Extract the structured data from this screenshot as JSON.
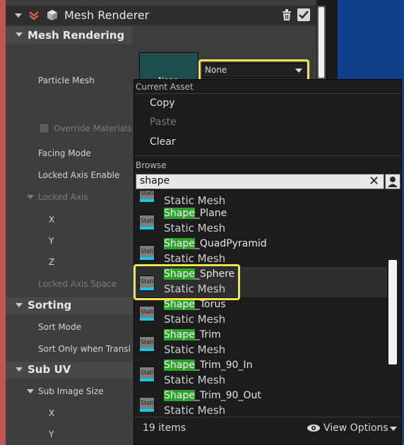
{
  "header": {
    "title": "Mesh Renderer"
  },
  "sections": {
    "mesh_rendering": "Mesh Rendering",
    "sorting": "Sorting",
    "sub_uv": "Sub UV"
  },
  "properties": {
    "particle_mesh": "Particle Mesh",
    "override_materials": "Override Materials",
    "facing_mode": "Facing Mode",
    "locked_axis_enable": "Locked Axis Enable",
    "locked_axis": "Locked Axis",
    "x": "X",
    "y": "Y",
    "z": "Z",
    "locked_axis_space": "Locked Axis Space",
    "sort_mode": "Sort Mode",
    "sort_only_when_translucent": "Sort Only when Transl",
    "sub_image_size": "Sub Image Size",
    "sub_x": "X",
    "sub_y": "Y"
  },
  "mesh_picker": {
    "thumbnail_label": "None",
    "selected_value": "None"
  },
  "popup": {
    "current_asset_title": "Current Asset",
    "copy": "Copy",
    "paste": "Paste",
    "clear": "Clear",
    "browse_title": "Browse",
    "search_value": "shape",
    "items": [
      {
        "highlight": "",
        "rest": "",
        "type": "Static Mesh"
      },
      {
        "highlight": "Shape",
        "rest": "_Plane",
        "type": "Static Mesh"
      },
      {
        "highlight": "Shape",
        "rest": "_QuadPyramid",
        "type": "Static Mesh"
      },
      {
        "highlight": "Shape",
        "rest": "_Sphere",
        "type": "Static Mesh"
      },
      {
        "highlight": "Shape",
        "rest": "_Torus",
        "type": "Static Mesh"
      },
      {
        "highlight": "Shape",
        "rest": "_Trim",
        "type": "Static Mesh"
      },
      {
        "highlight": "Shape",
        "rest": "_Trim_90_In",
        "type": "Static Mesh"
      },
      {
        "highlight": "Shape",
        "rest": "_Trim_90_Out",
        "type": "Static Mesh"
      }
    ],
    "icon_text": "Stati",
    "item_count": "19 items",
    "view_options": "View Options"
  },
  "colors": {
    "highlight_yellow": "#f6e44c",
    "search_match_green": "#2ca32a",
    "thumbnail_teal": "#1f4f4c",
    "mesh_icon_cyan": "#15c6e6"
  }
}
